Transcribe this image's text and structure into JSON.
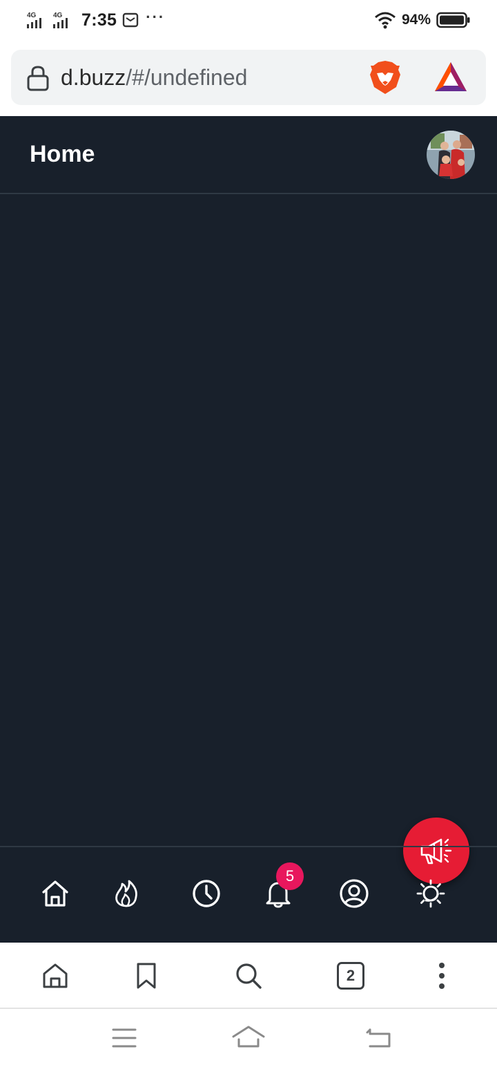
{
  "status_bar": {
    "signal_1_label": "4G",
    "signal_2_label": "4G",
    "time": "7:35",
    "more": "···",
    "battery_percent": "94%"
  },
  "browser": {
    "url_domain": "d.buzz",
    "url_path": "/#/undefined",
    "tab_count": "2"
  },
  "app": {
    "header_title": "Home",
    "notification_count": "5",
    "colors": {
      "background": "#18202b",
      "fab": "#e61c34",
      "badge": "#e8175d"
    },
    "nav_items": [
      "home-icon",
      "trending-flame-icon",
      "latest-clock-icon",
      "notifications-bell-icon",
      "profile-icon",
      "theme-toggle-icon"
    ]
  },
  "browser_toolbar": [
    "home-icon",
    "bookmark-icon",
    "search-icon",
    "tab-switcher",
    "menu-icon"
  ],
  "system_nav": [
    "recent-apps-icon",
    "home-icon",
    "back-icon"
  ]
}
